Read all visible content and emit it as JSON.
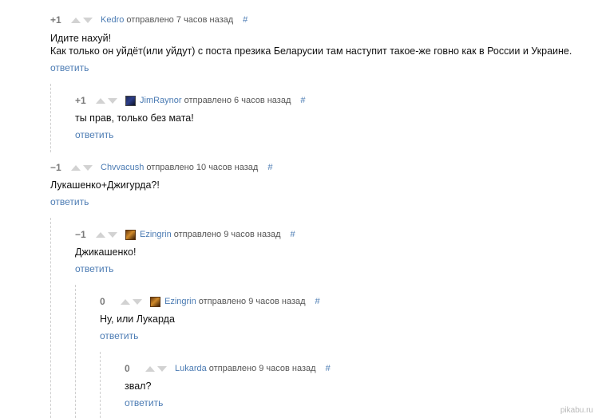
{
  "reply_label": "ответить",
  "hash_label": "#",
  "comments": [
    {
      "rating": "+1",
      "user": "Kedro",
      "time": "отправлено 7 часов назад",
      "lines": [
        "Идите нахуй!",
        "Как только он уйдёт(или уйдут) с поста презика Беларусии там наступит такое-же говно как в России и Украине."
      ]
    },
    {
      "rating": "+1",
      "user": "JimRaynor",
      "time": "отправлено 6 часов назад",
      "lines": [
        "ты прав, только без мата!"
      ]
    },
    {
      "rating": "−1",
      "user": "Chvvacush",
      "time": "отправлено 10 часов назад",
      "lines": [
        "Лукашенко+Джигурда?!"
      ]
    },
    {
      "rating": "−1",
      "user": "Ezingrin",
      "time": "отправлено 9 часов назад",
      "lines": [
        "Джикашенко!"
      ]
    },
    {
      "rating": "0",
      "user": "Ezingrin",
      "time": "отправлено 9 часов назад",
      "lines": [
        "Ну, или Лукарда"
      ]
    },
    {
      "rating": "0",
      "user": "Lukarda",
      "time": "отправлено 9 часов назад",
      "lines": [
        "звал?"
      ]
    }
  ],
  "watermark": "pikabu.ru"
}
